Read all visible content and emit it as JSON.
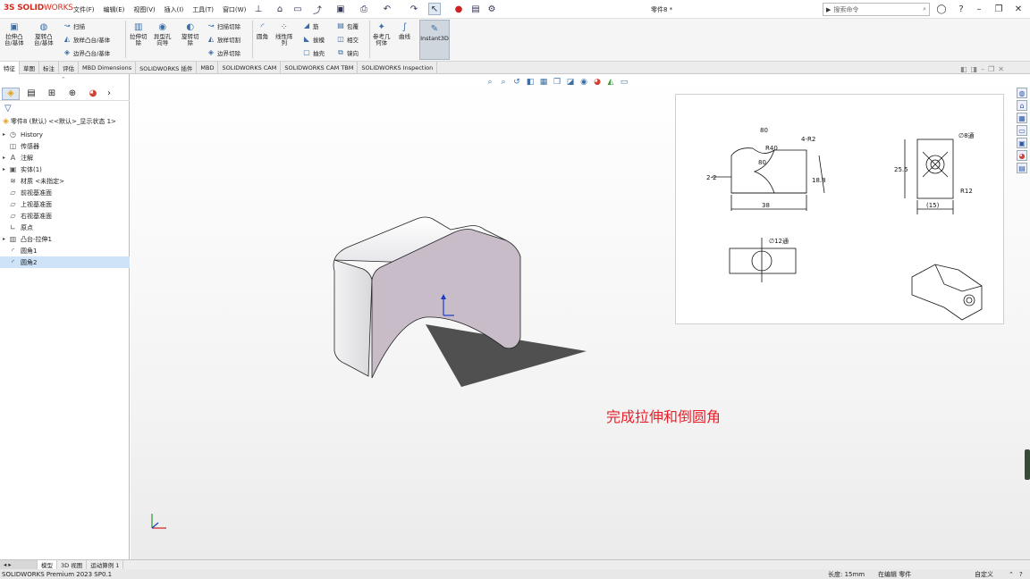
{
  "app": {
    "logo_prefix": "3S SOLID",
    "logo_suffix": "WORKS",
    "document_title": "零件8 *"
  },
  "menu": [
    "文件(F)",
    "编辑(E)",
    "视图(V)",
    "插入(I)",
    "工具(T)",
    "窗口(W)"
  ],
  "search": {
    "placeholder": "搜索命令"
  },
  "ribbon": {
    "features": [
      {
        "label": "拉伸凸\n台/基体",
        "icon": "extrude-boss-icon"
      },
      {
        "label": "旋转凸\n台/基体",
        "icon": "revolve-boss-icon"
      }
    ],
    "feature_list": [
      "扫描",
      "放样凸台/基体",
      "边界凸台/基体"
    ],
    "cut_features": [
      {
        "label": "拉伸切\n除",
        "icon": "extrude-cut-icon"
      },
      {
        "label": "异型孔\n向导",
        "icon": "hole-wizard-icon"
      },
      {
        "label": "旋转切\n除",
        "icon": "revolve-cut-icon"
      }
    ],
    "cut_list": [
      "扫描切除",
      "放样切割",
      "边界切除"
    ],
    "fillet": "圆角",
    "pattern": "线性阵\n列",
    "misc_list": [
      "筋",
      "拔模",
      "抽壳"
    ],
    "misc_list2": [
      "包覆",
      "相交",
      "镜向"
    ],
    "ref_geometry": "参考几\n何体",
    "curves": "曲线",
    "instant3d": "Instant3D"
  },
  "command_tabs": [
    "特征",
    "草图",
    "标注",
    "评估",
    "MBD Dimensions",
    "SOLIDWORKS 插件",
    "MBD",
    "SOLIDWORKS CAM",
    "SOLIDWORKS CAM TBM",
    "SOLIDWORKS Inspection"
  ],
  "tree": {
    "root": "零件8 (默认) <<默认>_显示状态 1>",
    "items": [
      {
        "label": "History",
        "icon": "history-icon",
        "expandable": true
      },
      {
        "label": "传感器",
        "icon": "sensor-icon",
        "expandable": false
      },
      {
        "label": "注解",
        "icon": "annotation-icon",
        "expandable": true
      },
      {
        "label": "实体(1)",
        "icon": "solid-body-icon",
        "expandable": true
      },
      {
        "label": "材质 <未指定>",
        "icon": "material-icon",
        "expandable": false
      },
      {
        "label": "前视基准面",
        "icon": "plane-icon",
        "expandable": false
      },
      {
        "label": "上视基准面",
        "icon": "plane-icon",
        "expandable": false
      },
      {
        "label": "右视基准面",
        "icon": "plane-icon",
        "expandable": false
      },
      {
        "label": "原点",
        "icon": "origin-icon",
        "expandable": false
      },
      {
        "label": "凸台-拉伸1",
        "icon": "boss-extrude-icon",
        "expandable": true
      },
      {
        "label": "圆角1",
        "icon": "fillet-icon",
        "expandable": false
      },
      {
        "label": "圆角2",
        "icon": "fillet-icon",
        "expandable": false,
        "selected": true
      }
    ]
  },
  "drawing": {
    "dims": {
      "section": "2-2",
      "a1": "80",
      "a2": "80",
      "r40": "R40",
      "r4": "4-R2",
      "d18": "18.8",
      "w38": "38",
      "h25": "25.5",
      "phi8": "∅8通",
      "r12": "R12",
      "w15": "(15)",
      "phi12": "∅12通"
    }
  },
  "annotation_text": "完成拉伸和倒圆角",
  "bottom_tabs": [
    "模型",
    "3D 视图",
    "运动算例 1"
  ],
  "status": {
    "product": "SOLIDWORKS Premium 2023 SP0.1",
    "length": "长度: 15mm",
    "mode": "在编辑 零件",
    "units": "自定义"
  }
}
